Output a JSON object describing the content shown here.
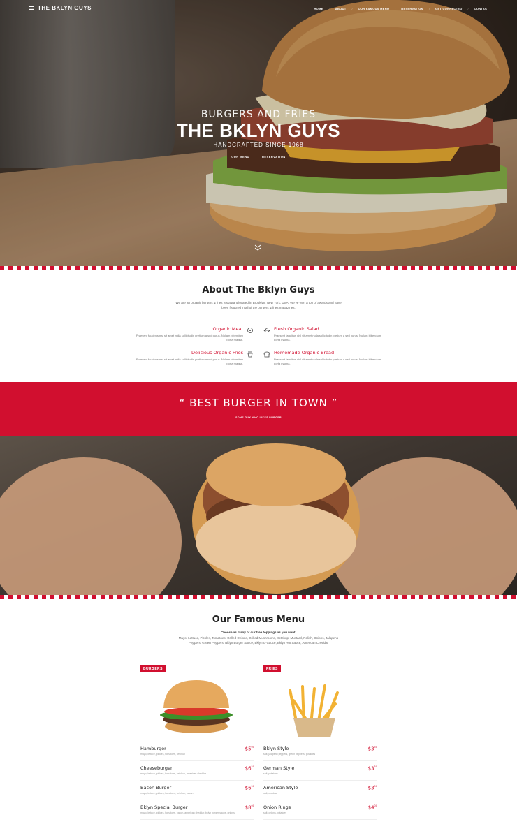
{
  "nav": {
    "logo_text": "THE BKLYN GUYS",
    "items": [
      "HOME",
      "ABOUT",
      "OUR FAMOUS MENU",
      "RESERVATION",
      "GET CONNECTED",
      "CONTACT"
    ]
  },
  "hero": {
    "subtitle": "BURGERS AND FRIES",
    "title": "THE BKLYN GUYS",
    "tagline": "HANDCRAFTED SINCE 1968",
    "links": [
      "OUR MENU",
      "RESERVATION"
    ]
  },
  "about": {
    "title": "About The Bklyn Guys",
    "description": "We are an organic burgers & fries restaurant located in Brooklyn, New York, USA. We've won a ton of awards and have been featured in all of the burgers & fries magazines.",
    "features": [
      {
        "title": "Organic Meat",
        "text": "Praesent faucibus nisl sit amet nulla sollicitudin pretium a sed purus. Nullam bibendum porta magna."
      },
      {
        "title": "Fresh Organic Salad",
        "text": "Praesent faucibus nisl sit amet nulla sollicitudin pretium a sed purus. Nullam bibendum porta magna."
      },
      {
        "title": "Delicious Organic Fries",
        "text": "Praesent faucibus nisl sit amet nulla sollicitudin pretium a sed purus. Nullam bibendum porta magna."
      },
      {
        "title": "Homemade Organic Bread",
        "text": "Praesent faucibus nisl sit amet nulla sollicitudin pretium a sed purus. Nullam bibendum porta magna."
      }
    ]
  },
  "quote": {
    "open": "“",
    "text": "BEST BURGER IN TOWN",
    "close": "”",
    "author": "SOME GUY WHO LIKES BURGER"
  },
  "menu": {
    "title": "Our Famous Menu",
    "lead": "Choose as many of our free toppings as you want!",
    "toppings": "Mayo, Lettuce, Pickles, Tomatoes, Grilled Onions, Grilled Mushrooms, Ketchup, Mustard, Relish, Onions, Jalapeno Peppers, Green Peppers, Bklyn Burger Sauce, Bklyn G-Sauce, Bklyn Hot Sauce, American Cheddar",
    "burgers": {
      "label": "BURGERS",
      "items": [
        {
          "name": "Hamburger",
          "desc": "mayo, lettuce, pickles, tomatoes, ketchup",
          "price": "$5",
          "cents": "00"
        },
        {
          "name": "Cheeseburger",
          "desc": "mayo, lettuce, pickles, tomatoes, ketchup, american cheddar",
          "price": "$6",
          "cents": "50"
        },
        {
          "name": "Bacon Burger",
          "desc": "mayo, lettuce, pickles, tomatoes, ketchup, bacon",
          "price": "$6",
          "cents": "50"
        },
        {
          "name": "Bklyn Special Burger",
          "desc": "mayo, lettuce, pickles, tomatoes, bacon, american cheddar, bklyn burger sauce, onions",
          "price": "$8",
          "cents": "00"
        }
      ]
    },
    "fries": {
      "label": "FRIES",
      "items": [
        {
          "name": "Bklyn Style",
          "desc": "salt, jalapeno peppers, green peppers, potatoes",
          "price": "$3",
          "cents": "50"
        },
        {
          "name": "German Style",
          "desc": "salt, potatoes",
          "price": "$3",
          "cents": "50"
        },
        {
          "name": "American Style",
          "desc": "salt, cheddar",
          "price": "$3",
          "cents": "50"
        },
        {
          "name": "Onion Rings",
          "desc": "salt, onions, potatoes",
          "price": "$4",
          "cents": "00"
        }
      ]
    }
  },
  "colors": {
    "accent": "#d10f2f"
  }
}
